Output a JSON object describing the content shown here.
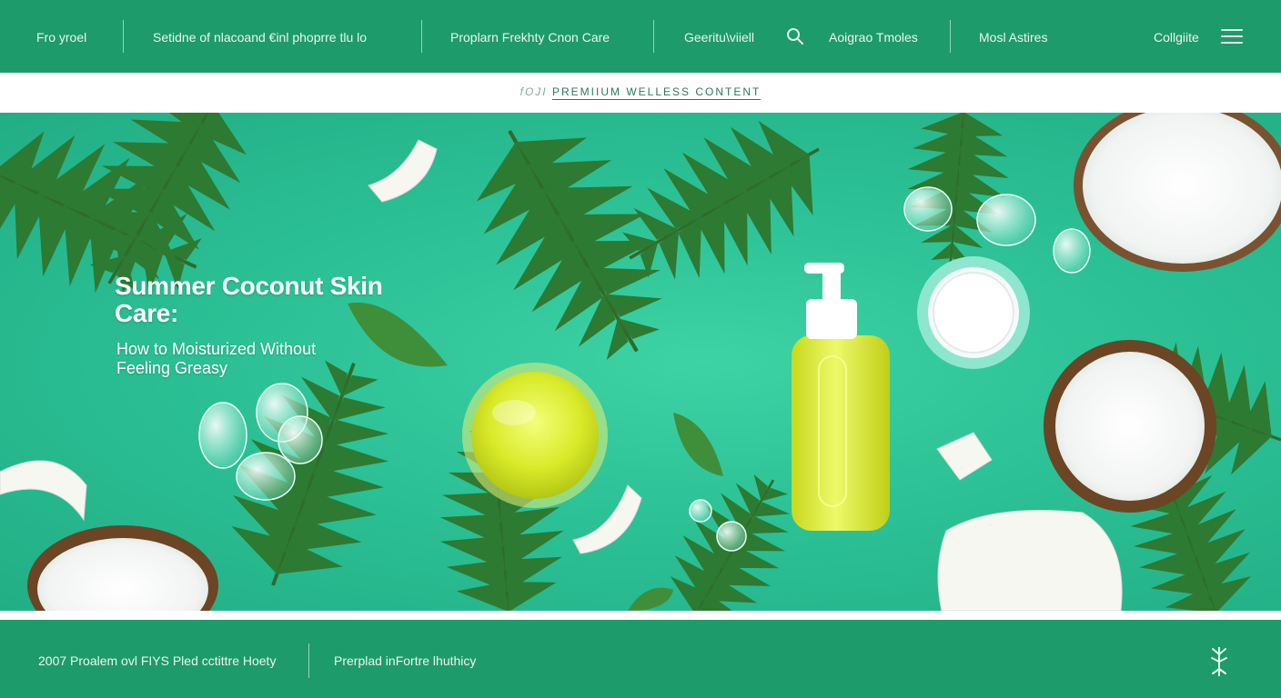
{
  "nav": {
    "links": [
      "Fro yroel",
      "Setidne of nlacoand €inl phoprre tlu lo",
      "Proplarn Frekhty Cnon Care",
      "Geeritu\\viiell",
      "Aoigrao Tmoles",
      "Mosl Astires",
      "Collgiite"
    ],
    "search_icon": "search-icon",
    "menu_icon": "hamburger-menu-icon"
  },
  "strip": {
    "lead": "fOJI",
    "link": "PREMIIUM WELLESS CONTENT"
  },
  "hero": {
    "title": "Summer Coconut Skin Care:",
    "subtitle": "How to Moisturized Without Feeling Greasy"
  },
  "footer": {
    "left": "2007 Proalem ovl FIYS Pled cctittre Hoety",
    "right": "Prerplad inFortre lhuthicy",
    "logo_icon": "leaf-sparkle-icon"
  },
  "colors": {
    "brand_green": "#1e9b6a",
    "hero_green": "#2cc196",
    "text_light": "#e8f6ef"
  }
}
